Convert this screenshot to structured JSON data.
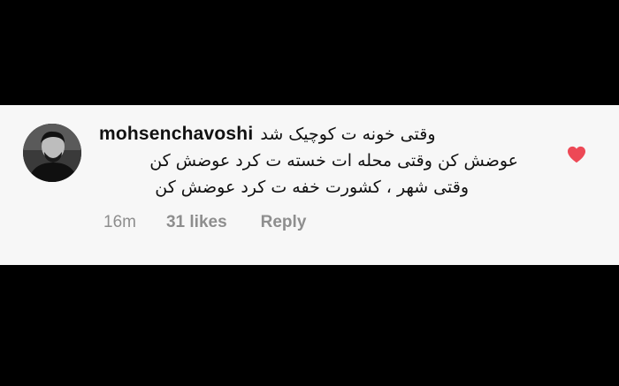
{
  "comment": {
    "username": "mohsenchavoshi",
    "lines": [
      "وقتی خونه ت کوچیک شد",
      "عوضش کن وقتی محله ات خسته ت کرد عوضش کن",
      "وقتی شهر ، کشورت خفه ت کرد عوضش کن"
    ],
    "time": "16m",
    "likes": "31 likes",
    "reply_label": "Reply"
  },
  "icons": {
    "like": "heart-icon",
    "avatar": "profile-photo"
  },
  "colors": {
    "card_background": "#f7f7f7",
    "letterbox": "#000000",
    "heart": "#ed4956",
    "meta_text": "#8e8e8e"
  }
}
